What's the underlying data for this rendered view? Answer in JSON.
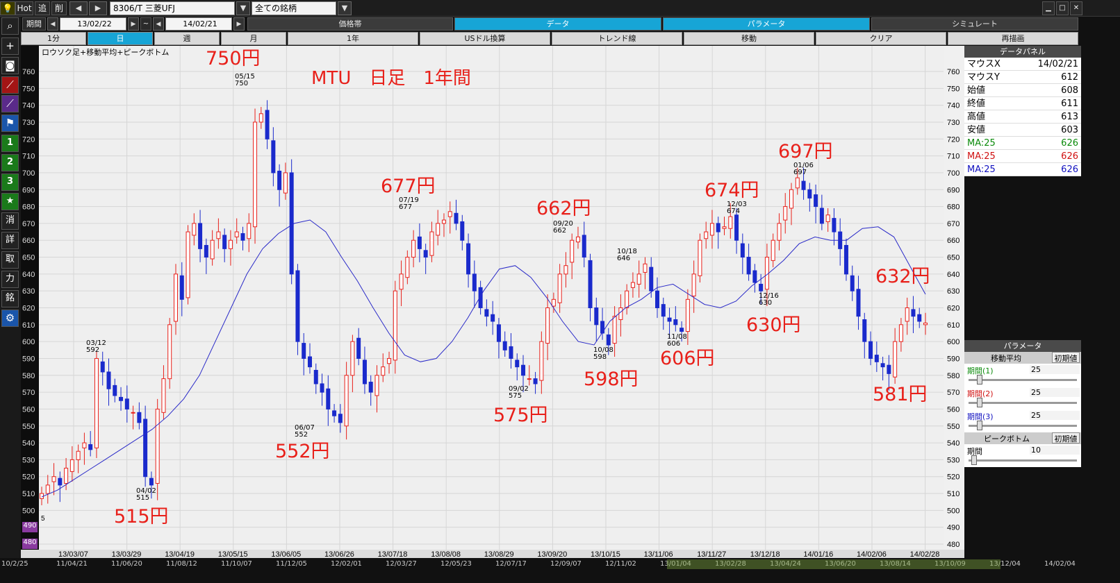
{
  "toolbar": {
    "hot": "Hot",
    "back": "追",
    "del": "削",
    "prev": "◀",
    "next": "▶",
    "symbol": "8306/T 三菱UFJ",
    "filter": "全ての銘柄",
    "dropdown": "▼",
    "period_label": "期間",
    "date_from": "13/02/22",
    "tilde": "~",
    "date_to": "14/02/21"
  },
  "tabs_row1": [
    "価格帯",
    "データ",
    "パラメータ",
    "シミュレート"
  ],
  "tabs_row2": [
    "1分",
    "日",
    "週",
    "月",
    "1年",
    "USドル換算",
    "トレンド線",
    "移動",
    "クリア",
    "再描画"
  ],
  "left_tools": [
    "+",
    "消",
    "詳",
    "取",
    "力",
    "銘",
    "1",
    "2",
    "3",
    "★"
  ],
  "chart_title": "ロウソク足+移動平均+ピークボトム",
  "overlay_title": "MTU　日足　1年間",
  "data_panel": {
    "title": "データパネル",
    "rows": [
      {
        "k": "マウスX",
        "v": "14/02/21"
      },
      {
        "k": "マウスY",
        "v": "612"
      },
      {
        "k": "始値",
        "v": "608"
      },
      {
        "k": "終値",
        "v": "611"
      },
      {
        "k": "高値",
        "v": "613"
      },
      {
        "k": "安値",
        "v": "603"
      }
    ],
    "ma": [
      {
        "k": "MA:25",
        "v": "626",
        "color": "#0a8a0a"
      },
      {
        "k": "MA:25",
        "v": "626",
        "color": "#d01010"
      },
      {
        "k": "MA:25",
        "v": "626",
        "color": "#1010c0"
      }
    ]
  },
  "param_panel": {
    "title": "パラメータ",
    "ma_label": "移動平均",
    "reset": "初期値",
    "p1": "期間(1)",
    "p1v": "25",
    "p2": "期間(2)",
    "p2v": "25",
    "p3": "期間(3)",
    "p3v": "25",
    "pb_label": "ピークボトム",
    "pb_reset": "初期値",
    "pb_period": "期間",
    "pb_v": "10"
  },
  "bottom_axis_labels": [
    "10/2/25",
    "11/04/21",
    "11/06/20",
    "11/08/12",
    "11/10/07",
    "11/12/05",
    "12/02/01",
    "12/03/27",
    "12/05/23",
    "12/07/17",
    "12/09/07",
    "12/11/02",
    "13/01/04",
    "13/02/28",
    "13/04/24",
    "13/06/20",
    "13/08/14",
    "13/10/09",
    "13/12/04",
    "14/02/04"
  ],
  "left_extra": [
    "490",
    "480"
  ],
  "annotations": [
    "750円",
    "515円",
    "552円",
    "677円",
    "575円",
    "662円",
    "598円",
    "606円",
    "674円",
    "630円",
    "697円",
    "632円",
    "581円"
  ],
  "peak_labels": [
    {
      "d": "03/12",
      "v": "592"
    },
    {
      "d": "04/02",
      "v": "515"
    },
    {
      "d": "05/15",
      "v": "750"
    },
    {
      "d": "06/07",
      "v": "552"
    },
    {
      "d": "07/19",
      "v": "677"
    },
    {
      "d": "09/02",
      "v": "575"
    },
    {
      "d": "09/20",
      "v": "662"
    },
    {
      "d": "10/08",
      "v": "598"
    },
    {
      "d": "10/18",
      "v": "646"
    },
    {
      "d": "11/08",
      "v": "606"
    },
    {
      "d": "12/03",
      "v": "674"
    },
    {
      "d": "12/16",
      "v": "630"
    },
    {
      "d": "01/06",
      "v": "697"
    }
  ],
  "chart_data": {
    "type": "candlestick",
    "title": "ロウソク足+移動平均+ピークボトム",
    "ylim": [
      480,
      765
    ],
    "yticks": [
      760,
      750,
      740,
      730,
      720,
      710,
      700,
      690,
      680,
      670,
      660,
      650,
      640,
      630,
      620,
      610,
      600,
      590,
      580,
      570,
      560,
      550,
      540,
      530,
      520,
      510,
      500,
      490,
      480
    ],
    "xlabels": [
      "13/03/07",
      "13/03/29",
      "13/04/19",
      "13/05/15",
      "13/06/05",
      "13/06/26",
      "13/07/18",
      "13/08/08",
      "13/08/29",
      "13/09/20",
      "13/10/15",
      "13/11/06",
      "13/11/27",
      "13/12/18",
      "14/01/16",
      "14/02/06",
      "14/02/28"
    ],
    "close_series": [
      510,
      515,
      520,
      515,
      525,
      530,
      535,
      540,
      536,
      590,
      582,
      572,
      568,
      565,
      560,
      558,
      552,
      520,
      515,
      560,
      578,
      610,
      640,
      625,
      665,
      670,
      655,
      650,
      660,
      665,
      655,
      660,
      665,
      660,
      670,
      730,
      735,
      720,
      700,
      690,
      700,
      640,
      600,
      590,
      585,
      575,
      570,
      560,
      556,
      552,
      580,
      600,
      590,
      575,
      570,
      580,
      585,
      590,
      630,
      640,
      650,
      660,
      655,
      650,
      665,
      670,
      672,
      677,
      670,
      660,
      640,
      630,
      620,
      615,
      612,
      600,
      595,
      590,
      585,
      580,
      578,
      575,
      600,
      620,
      625,
      640,
      645,
      660,
      662,
      650,
      620,
      610,
      605,
      598,
      615,
      620,
      630,
      635,
      640,
      646,
      630,
      620,
      615,
      612,
      610,
      606,
      625,
      640,
      660,
      665,
      670,
      665,
      668,
      674,
      660,
      650,
      640,
      635,
      630,
      650,
      660,
      670,
      680,
      690,
      697,
      690,
      685,
      680,
      670,
      675,
      665,
      655,
      640,
      630,
      615,
      600,
      590,
      588,
      585,
      581,
      600,
      610,
      620,
      615,
      612,
      611
    ],
    "ma25": [
      508,
      512,
      518,
      524,
      530,
      536,
      542,
      548,
      556,
      566,
      580,
      600,
      620,
      640,
      655,
      664,
      670,
      672,
      665,
      650,
      636,
      620,
      605,
      592,
      588,
      590,
      600,
      614,
      630,
      643,
      645,
      638,
      626,
      612,
      600,
      598,
      612,
      620,
      625,
      632,
      634,
      628,
      622,
      620,
      624,
      633,
      640,
      648,
      658,
      662,
      660,
      660,
      667,
      668,
      662,
      645,
      628
    ]
  },
  "colors": {
    "up": "#e8201a",
    "down": "#1a2acc",
    "ma": "#2a2ac8",
    "annotation": "#e8201a",
    "tab_active": "#17a5d6"
  }
}
